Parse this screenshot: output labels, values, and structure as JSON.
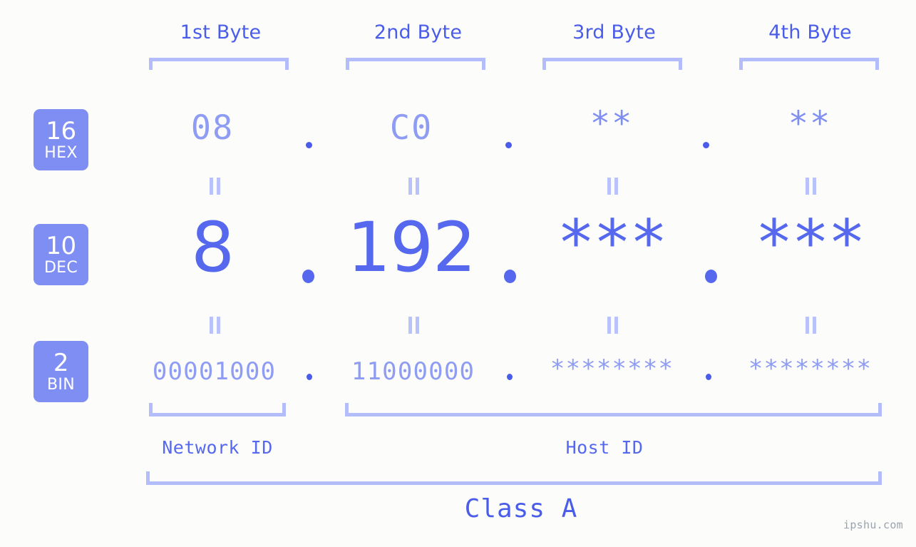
{
  "page": {
    "background_color": "#fcfdfa",
    "accent_color": "#5568ee",
    "accent_light_color": "#8e9cf3",
    "bracket_color": "#b3bdfb",
    "badge_color": "#7f8ef2",
    "watermark": "ipshu.com"
  },
  "headers": [
    {
      "label": "1st Byte"
    },
    {
      "label": "2nd Byte"
    },
    {
      "label": "3rd Byte"
    },
    {
      "label": "4th Byte"
    }
  ],
  "rows": [
    {
      "badge_number": "16",
      "badge_abbr": "HEX",
      "values": [
        "08",
        "C0",
        "**",
        "**"
      ],
      "separators": [
        ".",
        ".",
        "."
      ]
    },
    {
      "badge_number": "10",
      "badge_abbr": "DEC",
      "values": [
        "8",
        "192",
        "***",
        "***"
      ],
      "separators": [
        ".",
        ".",
        "."
      ]
    },
    {
      "badge_number": "2",
      "badge_abbr": "BIN",
      "values": [
        "00001000",
        "11000000",
        "********",
        "********"
      ],
      "separators": [
        ".",
        ".",
        "."
      ]
    }
  ],
  "footer": {
    "network_id_label": "Network ID",
    "host_id_label": "Host ID",
    "class_label": "Class A"
  },
  "chart_data": {
    "type": "table",
    "title": "IP Address Byte Breakdown",
    "columns": [
      "1st Byte",
      "2nd Byte",
      "3rd Byte",
      "4th Byte"
    ],
    "rows": [
      {
        "base": "16",
        "base_name": "HEX",
        "cells": [
          "08",
          "C0",
          "**",
          "**"
        ]
      },
      {
        "base": "10",
        "base_name": "DEC",
        "cells": [
          "8",
          "192",
          "***",
          "***"
        ]
      },
      {
        "base": "2",
        "base_name": "BIN",
        "cells": [
          "00001000",
          "11000000",
          "********",
          "********"
        ]
      }
    ],
    "annotations": {
      "network_id_span": [
        "1st Byte"
      ],
      "host_id_span": [
        "2nd Byte",
        "3rd Byte",
        "4th Byte"
      ],
      "class": "Class A"
    }
  }
}
